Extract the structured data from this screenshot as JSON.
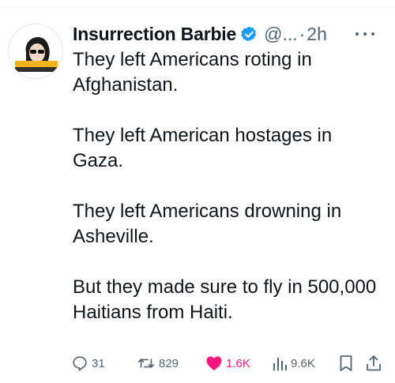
{
  "user": {
    "display_name": "Insurrection Barbie",
    "handle": "@...",
    "separator": "·",
    "time": "2h",
    "verified_icon": "verified-badge-icon"
  },
  "tweet": {
    "paragraphs": [
      "They left Americans roting in Afghanistan.",
      "They left American hostages in Gaza.",
      "They left Americans drowning in Asheville.",
      "But they made sure to fly in 500,000 Haitians from Haiti."
    ]
  },
  "actions": {
    "replies": "31",
    "reposts": "829",
    "likes": "1.6K",
    "views": "9.6K"
  },
  "colors": {
    "text": "#0f1419",
    "muted": "#536471",
    "verified": "#1d9bf0",
    "like": "#f91880"
  }
}
